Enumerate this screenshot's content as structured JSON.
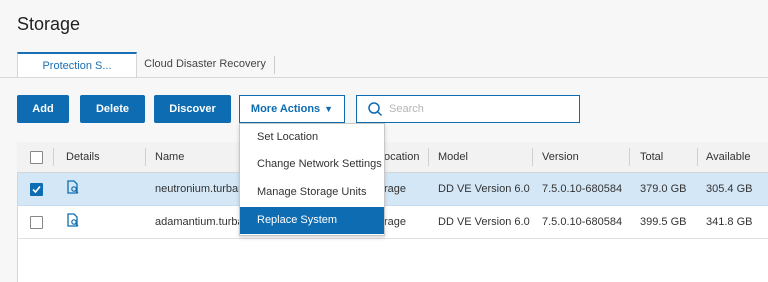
{
  "page": {
    "title": "Storage"
  },
  "tabs": [
    {
      "label": "Protection S...",
      "active": true
    },
    {
      "label": "Cloud Disaster Recovery",
      "active": false
    }
  ],
  "toolbar": {
    "add_label": "Add",
    "delete_label": "Delete",
    "discover_label": "Discover",
    "more_actions_label": "More Actions",
    "search_placeholder": "Search",
    "search_value": ""
  },
  "menu": {
    "items": [
      {
        "label": "Set Location",
        "selected": false
      },
      {
        "label": "Change Network Settings",
        "selected": false
      },
      {
        "label": "Manage Storage Units",
        "selected": false
      },
      {
        "label": "Replace System",
        "selected": true
      }
    ]
  },
  "table": {
    "columns": [
      "Details",
      "Name",
      "Location",
      "Model",
      "Version",
      "Total",
      "Available"
    ],
    "visible_column_labels": {
      "details": "Details",
      "name": "Name",
      "location": "ocation",
      "model": "Model",
      "version": "Version",
      "total": "Total",
      "available": "Available"
    },
    "rows": [
      {
        "checked": true,
        "name": "neutronium.turbam",
        "location": "rage",
        "model": "DD VE Version 6.0",
        "version": "7.5.0.10-680584",
        "total": "379.0 GB",
        "available": "305.4 GB"
      },
      {
        "checked": false,
        "name": "adamantium.turbam",
        "location": "rage",
        "model": "DD VE Version 6.0",
        "version": "7.5.0.10-680584",
        "total": "399.5 GB",
        "available": "341.8 GB"
      }
    ]
  },
  "colors": {
    "accent": "#0e6cb2",
    "selected_row": "#d4e7f7"
  }
}
